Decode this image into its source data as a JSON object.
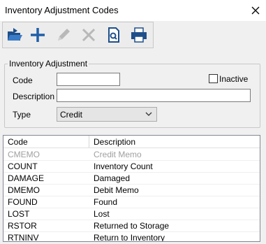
{
  "window": {
    "title": "Inventory Adjustment Codes"
  },
  "toolbar": {
    "buttons": [
      {
        "name": "open",
        "icon": "open-folder-icon"
      },
      {
        "name": "add",
        "icon": "plus-icon"
      },
      {
        "name": "edit",
        "icon": "pencil-icon",
        "disabled": true
      },
      {
        "name": "delete",
        "icon": "x-icon",
        "disabled": true
      },
      {
        "name": "preview",
        "icon": "print-preview-icon"
      },
      {
        "name": "print",
        "icon": "printer-icon"
      }
    ]
  },
  "form": {
    "group_title": "Inventory Adjustment",
    "code_label": "Code",
    "code_value": "",
    "inactive_label": "Inactive",
    "inactive_checked": false,
    "description_label": "Description",
    "description_value": "",
    "type_label": "Type",
    "type_value": "Credit"
  },
  "table": {
    "columns": [
      "Code",
      "Description"
    ],
    "rows": [
      {
        "code": "CMEMO",
        "description": "Credit Memo",
        "disabled": true
      },
      {
        "code": "COUNT",
        "description": "Inventory Count"
      },
      {
        "code": "DAMAGE",
        "description": "Damaged"
      },
      {
        "code": "DMEMO",
        "description": "Debit Memo"
      },
      {
        "code": "FOUND",
        "description": "Found"
      },
      {
        "code": "LOST",
        "description": "Lost"
      },
      {
        "code": "RSTOR",
        "description": "Returned to Storage"
      },
      {
        "code": "RTNINV",
        "description": "Return to Inventory"
      }
    ]
  },
  "colors": {
    "accent_blue": "#1f5fa8",
    "disabled_gray": "#a0a0a0"
  }
}
